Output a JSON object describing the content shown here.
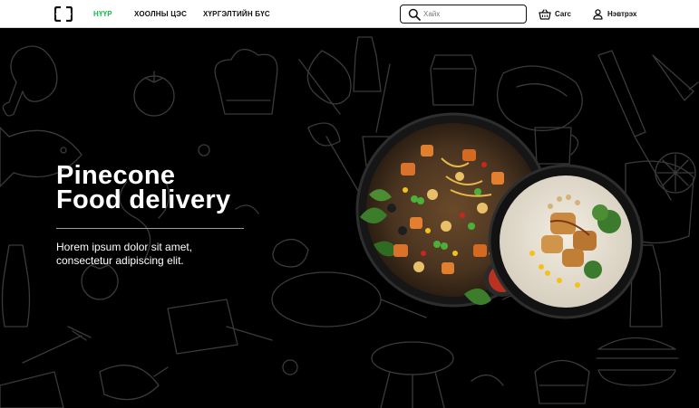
{
  "header": {
    "logo_icon": "curly-brackets-logo",
    "nav": [
      {
        "label": "НҮҮР",
        "active": true
      },
      {
        "label": "ХООЛНЫ ЦЭС",
        "active": false
      },
      {
        "label": "ХҮРГЭЛТИЙН БҮС",
        "active": false
      }
    ],
    "search": {
      "placeholder": "Хайх",
      "value": "",
      "icon": "search-icon"
    },
    "cart": {
      "label": "Сагс",
      "icon": "basket-icon"
    },
    "login": {
      "label": "Нэвтрэх",
      "icon": "user-icon"
    }
  },
  "hero": {
    "title_line1": "Pinecone",
    "title_line2": "Food delivery",
    "subtitle_line1": "Horem ipsum dolor sit amet,",
    "subtitle_line2": "consectetur adipiscing elit.",
    "image": "food-bowls-image",
    "background": "food-doodle-pattern"
  },
  "colors": {
    "accent": "#18ba51",
    "hero_background": "#000000",
    "header_background": "#ffffff"
  }
}
